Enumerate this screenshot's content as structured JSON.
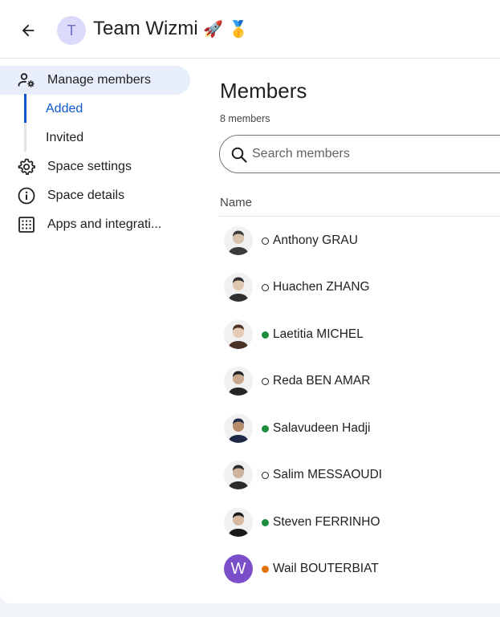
{
  "header": {
    "space_initial": "T",
    "space_name": "Team Wizmi",
    "emoji_1": "🚀",
    "emoji_2": "🥇"
  },
  "sidebar": {
    "manage_members": "Manage members",
    "sub_items": [
      "Added",
      "Invited"
    ],
    "space_settings": "Space settings",
    "space_details": "Space details",
    "apps": "Apps and integrati..."
  },
  "main": {
    "title": "Members",
    "count": "8 members",
    "search_placeholder": "Search members",
    "column_name": "Name"
  },
  "members": [
    {
      "name": "Anthony GRAU",
      "status": "offline",
      "avatar": "photo"
    },
    {
      "name": "Huachen ZHANG",
      "status": "offline",
      "avatar": "photo"
    },
    {
      "name": "Laetitia MICHEL",
      "status": "online",
      "avatar": "photo"
    },
    {
      "name": "Reda BEN AMAR",
      "status": "offline",
      "avatar": "photo"
    },
    {
      "name": "Salavudeen Hadji",
      "status": "online",
      "avatar": "photo"
    },
    {
      "name": "Salim MESSAOUDI",
      "status": "offline",
      "avatar": "photo"
    },
    {
      "name": "Steven FERRINHO",
      "status": "online",
      "avatar": "photo"
    },
    {
      "name": "Wail BOUTERBIAT",
      "status": "away",
      "avatar": "letter",
      "initial": "W"
    }
  ],
  "colors": {
    "accent": "#0b57d0",
    "active_bg": "#e8eefb",
    "online": "#1e8e3e",
    "away": "#e37400"
  }
}
